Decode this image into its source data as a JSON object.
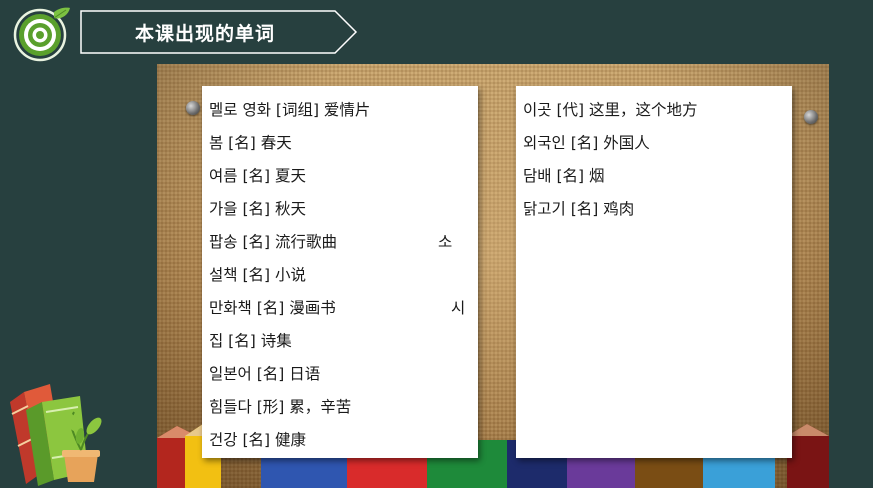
{
  "header": {
    "title": "本课出现的单词"
  },
  "icons": {
    "logo": "target-leaf-icon",
    "decor": "books-plant-icon"
  },
  "colors": {
    "background": "#27403f",
    "logo_green": "#5aa02c",
    "card": "#ffffff"
  },
  "vocab_left": [
    "멜로 영화 [词组] 爱情片",
    "봄 [名] 春天",
    "여름 [名] 夏天",
    "가을 [名] 秋天",
    "팝송 [名] 流行歌曲",
    "설책 [名] 小说",
    "만화책 [名] 漫画书",
    "집 [名] 诗集",
    "일본어 [名] 日语",
    "힘들다 [形] 累，辛苦",
    "건강 [名] 健康"
  ],
  "vocab_left_stray": [
    "소",
    "시"
  ],
  "vocab_right": [
    "이곳 [代] 这里，这个地方",
    "외국인 [名] 外国人",
    "담배 [名] 烟",
    "닭고기 [名] 鸡肉"
  ]
}
